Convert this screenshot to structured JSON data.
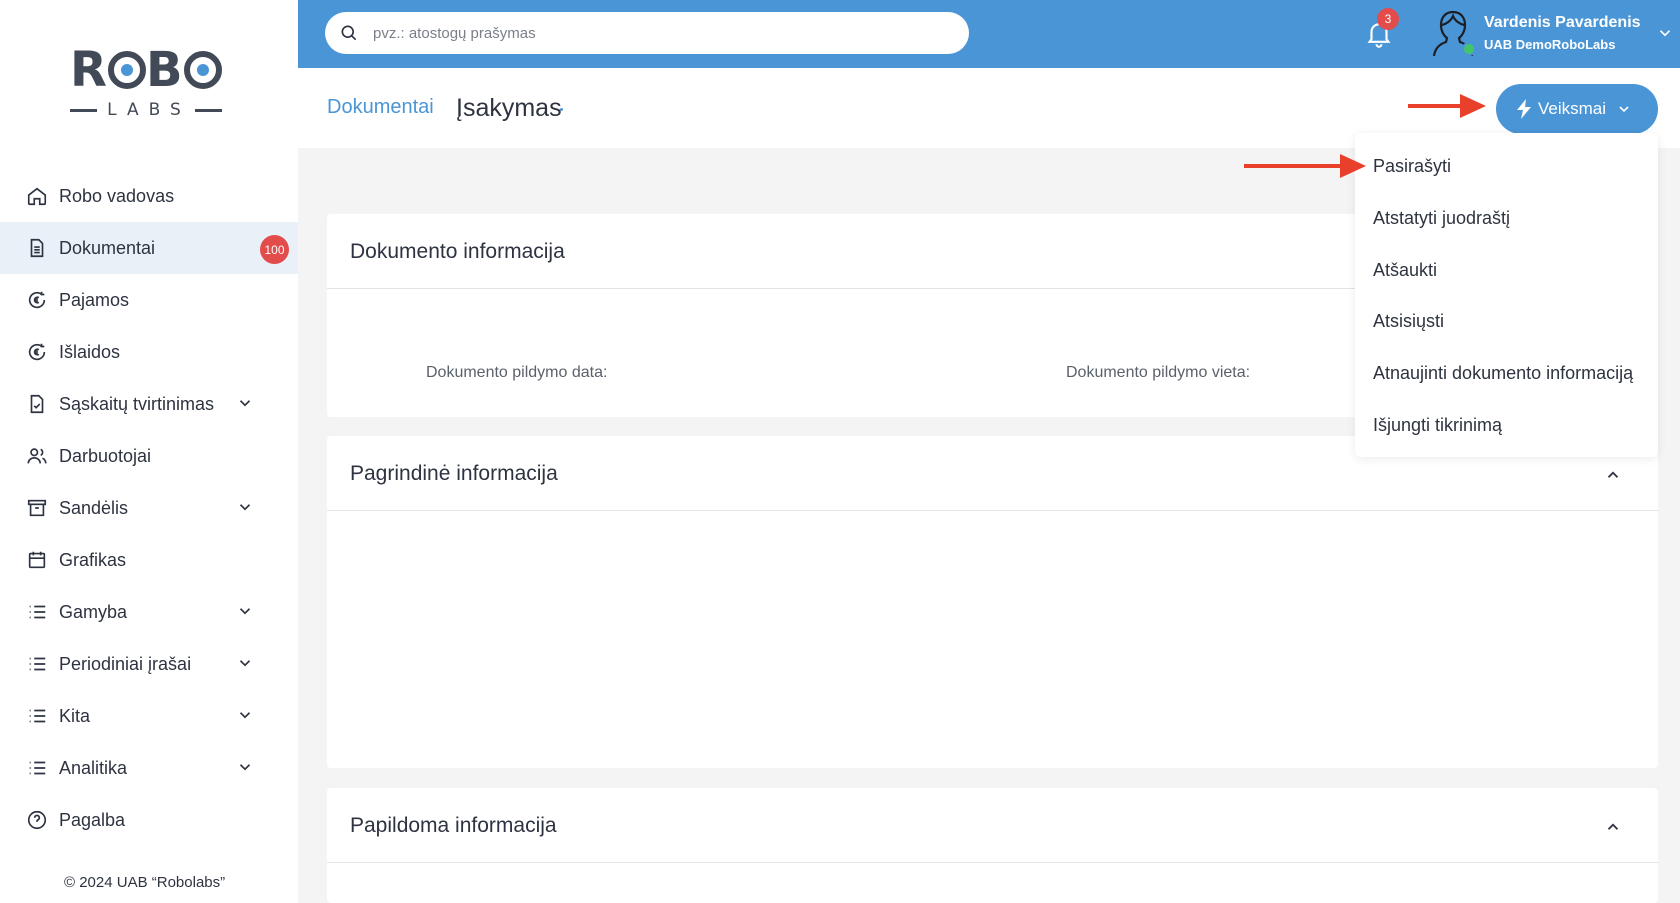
{
  "logo": {
    "main_left": "R",
    "main_mid": "B",
    "sub": "LABS"
  },
  "sidebar": {
    "items": [
      {
        "label": "Robo vadovas"
      },
      {
        "label": "Dokumentai",
        "badge": "100"
      },
      {
        "label": "Pajamos"
      },
      {
        "label": "Išlaidos"
      },
      {
        "label": "Sąskaitų tvirtinimas"
      },
      {
        "label": "Darbuotojai"
      },
      {
        "label": "Sandėlis"
      },
      {
        "label": "Grafikas"
      },
      {
        "label": "Gamyba"
      },
      {
        "label": "Periodiniai įrašai"
      },
      {
        "label": "Kita"
      },
      {
        "label": "Analitika"
      },
      {
        "label": "Pagalba"
      }
    ],
    "copyright": "© 2024 UAB “Robolabs”"
  },
  "topbar": {
    "search_placeholder": "pvz.: atostogų prašymas",
    "notifications_count": "3",
    "user_name": "Vardenis Pavardenis",
    "user_company": "UAB DemoRoboLabs"
  },
  "header": {
    "breadcrumb": "Dokumentai",
    "title": "Įsakymas",
    "actions_label": "Veiksmai"
  },
  "cards": {
    "doc_info": {
      "title": "Dokumento informacija",
      "fill_date_label": "Dokumento pildymo data:",
      "fill_place_label": "Dokumento pildymo vieta:"
    },
    "main_info": {
      "title": "Pagrindinė informacija"
    },
    "extra_info": {
      "title": "Papildoma informacija"
    }
  },
  "dropdown": {
    "items": [
      {
        "label": "Pasirašyti"
      },
      {
        "label": "Atstatyti juodraštį"
      },
      {
        "label": "Atšaukti"
      },
      {
        "label": "Atsisiųsti"
      },
      {
        "label": "Atnaujinti dokumento informaciją"
      },
      {
        "label": "Išjungti tikrinimą"
      }
    ]
  },
  "colors": {
    "brand_blue": "#4a95d6",
    "badge_red": "#e24c4b",
    "arrow_red": "#e8402a",
    "online_green": "#43c66a"
  }
}
